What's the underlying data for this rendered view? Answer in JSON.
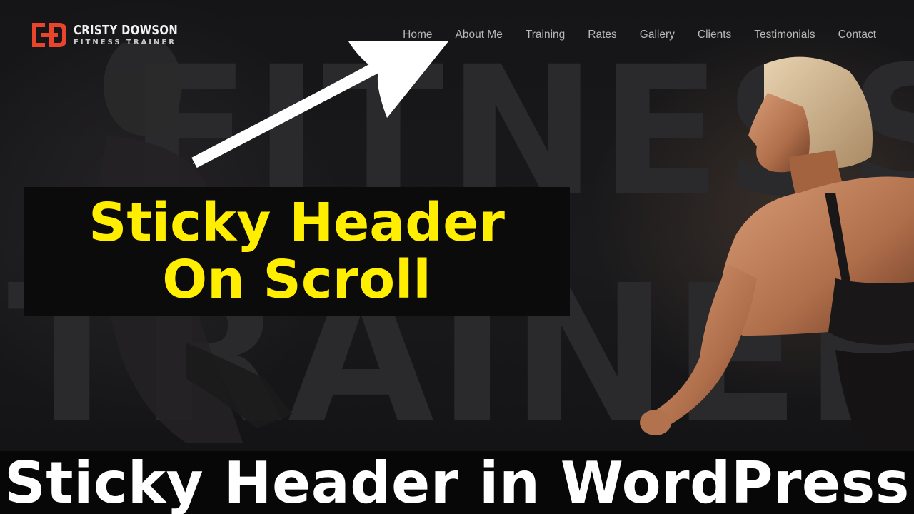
{
  "logo": {
    "mark_text": "CD",
    "name": "CRISTY DOWSON",
    "tagline": "FITNESS TRAINER",
    "mark_color": "#e8452c"
  },
  "nav": {
    "items": [
      {
        "label": "Home"
      },
      {
        "label": "About Me"
      },
      {
        "label": "Training"
      },
      {
        "label": "Rates"
      },
      {
        "label": "Gallery"
      },
      {
        "label": "Clients"
      },
      {
        "label": "Testimonials"
      },
      {
        "label": "Contact"
      }
    ]
  },
  "hero": {
    "watermark_line1": "FITNESS",
    "watermark_line2": "TRAINER"
  },
  "callout": {
    "line1": "Sticky Header",
    "line2": "On Scroll",
    "text_color": "#ffee00"
  },
  "banner": {
    "title": "Sticky Header in WordPress"
  },
  "icons": {
    "arrow": "arrow-up-right-icon",
    "logo": "cd-monogram-icon"
  }
}
